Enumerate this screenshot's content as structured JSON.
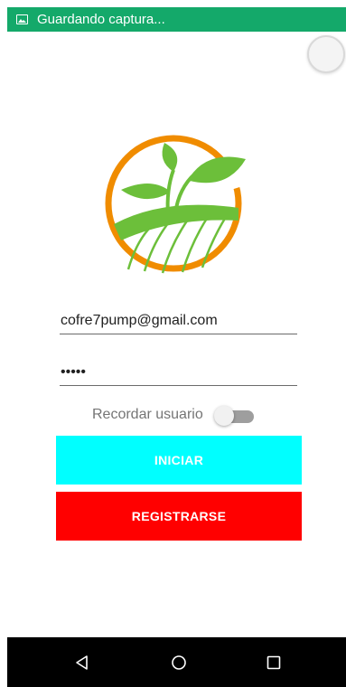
{
  "status_bar": {
    "text": "Guardando captura...",
    "icon": "image-icon",
    "color": "#14a96a"
  },
  "logo": {
    "icon": "plant-sprout-logo",
    "ring_color": "#f08c00",
    "leaf_color": "#6cbf3a"
  },
  "form": {
    "email_value": "cofre7pump@gmail.com",
    "password_value": "•••••",
    "remember_label": "Recordar usuario",
    "remember_on": false
  },
  "buttons": {
    "login_label": "INICIAR",
    "login_color": "#00ffff",
    "register_label": "REGISTRARSE",
    "register_color": "#ff0000"
  },
  "nav": {
    "back_icon": "triangle-back-icon",
    "home_icon": "circle-home-icon",
    "recents_icon": "square-recents-icon"
  }
}
